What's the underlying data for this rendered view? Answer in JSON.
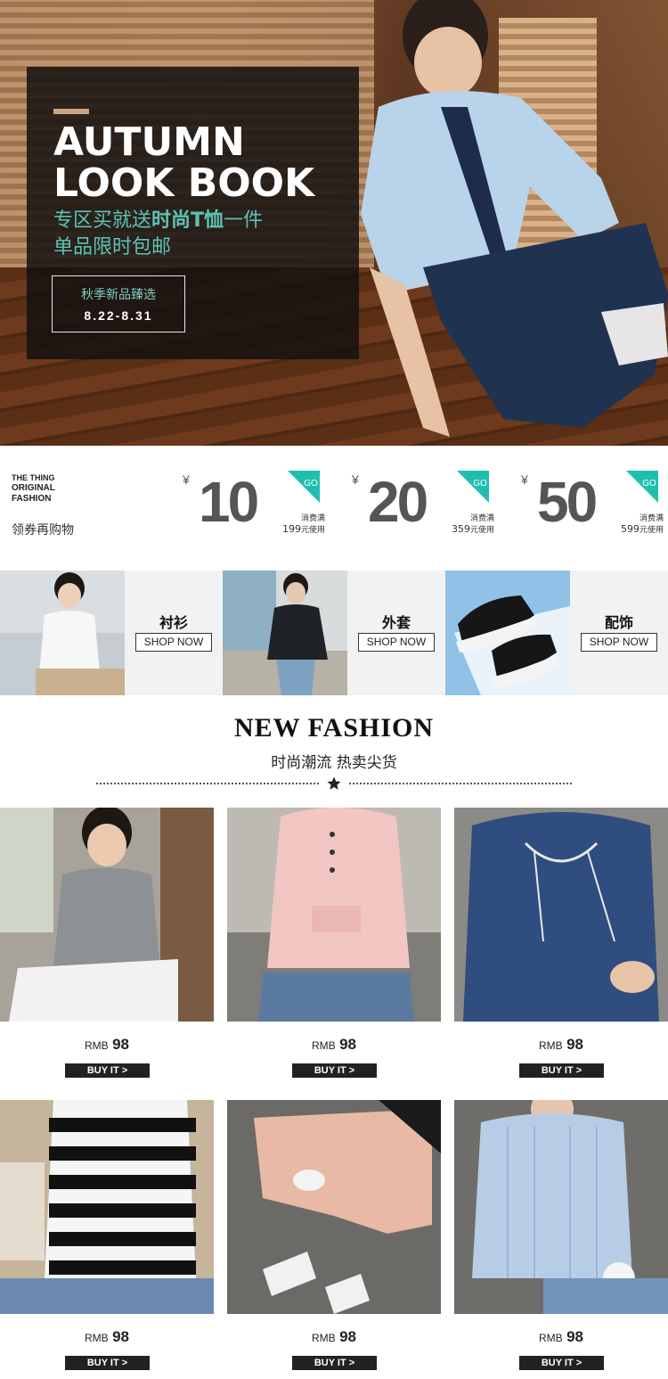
{
  "hero": {
    "title_line1": "AUTUMN",
    "title_line2": "LOOK BOOK",
    "sub_prefix": "专区买就送",
    "sub_bold": "时尚T恤",
    "sub_suffix": "一件",
    "sub_line2": "单品限时包邮",
    "box_line1": "秋季新品臻选",
    "box_line2": "8.22-8.31"
  },
  "brand": {
    "line1": "THE THING",
    "line2": "ORIGINAL",
    "line3": "FASHION",
    "cta": "领券再购物"
  },
  "coupons": [
    {
      "currency": "¥",
      "amount": "10",
      "go": "GO",
      "cond_label": "消费满",
      "cond_value": "199",
      "cond_unit": "元使用"
    },
    {
      "currency": "¥",
      "amount": "20",
      "go": "GO",
      "cond_label": "消费满",
      "cond_value": "359",
      "cond_unit": "元使用"
    },
    {
      "currency": "¥",
      "amount": "50",
      "go": "GO",
      "cond_label": "消费满",
      "cond_value": "599",
      "cond_unit": "元使用"
    }
  ],
  "categories": [
    {
      "name": "衬衫",
      "button": "SHOP NOW"
    },
    {
      "name": "外套",
      "button": "SHOP NOW"
    },
    {
      "name": "配饰",
      "button": "SHOP NOW"
    }
  ],
  "section": {
    "title": "NEW FASHION",
    "subtitle": "时尚潮流 热卖尖货"
  },
  "products": [
    {
      "currency": "RMB",
      "price": "98",
      "button": "BUY IT >"
    },
    {
      "currency": "RMB",
      "price": "98",
      "button": "BUY IT >"
    },
    {
      "currency": "RMB",
      "price": "98",
      "button": "BUY IT >"
    },
    {
      "currency": "RMB",
      "price": "98",
      "button": "BUY IT >"
    },
    {
      "currency": "RMB",
      "price": "98",
      "button": "BUY IT >"
    },
    {
      "currency": "RMB",
      "price": "98",
      "button": "BUY IT >"
    }
  ],
  "colors": {
    "accent_teal": "#1fbfaf",
    "overlay_bg": "#141210",
    "button_dark": "#222222"
  }
}
